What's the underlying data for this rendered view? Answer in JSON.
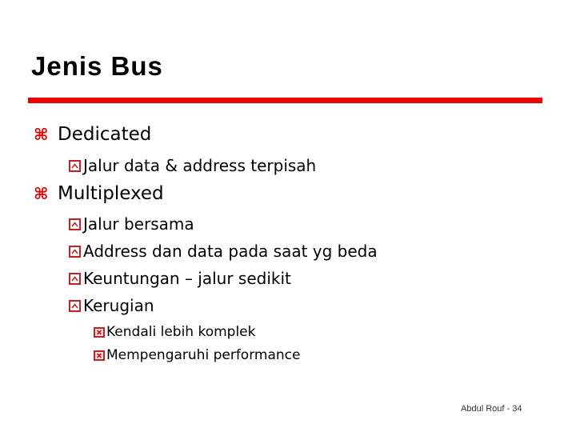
{
  "slide": {
    "title": "Jenis Bus",
    "accent_color": "#f20000",
    "bullets": [
      {
        "label": "Dedicated",
        "icon": "command-key-bullet-icon"
      },
      {
        "label": "Jalur data & address terpisah",
        "icon": "checkbox-bullet-icon"
      },
      {
        "label": "Multiplexed",
        "icon": "command-key-bullet-icon"
      },
      {
        "label": "Jalur bersama",
        "icon": "checkbox-bullet-icon"
      },
      {
        "label": "Address dan data pada saat yg beda",
        "icon": "checkbox-bullet-icon"
      },
      {
        "label": "Keuntungan – jalur sedikit",
        "icon": "checkbox-bullet-icon"
      },
      {
        "label": "Kerugian",
        "icon": "checkbox-bullet-icon"
      },
      {
        "label": "Kendali lebih komplek",
        "icon": "x-box-bullet-icon"
      },
      {
        "label": "Mempengaruhi performance",
        "icon": "x-box-bullet-icon"
      }
    ],
    "footer": "Abdul Rouf - 34"
  }
}
